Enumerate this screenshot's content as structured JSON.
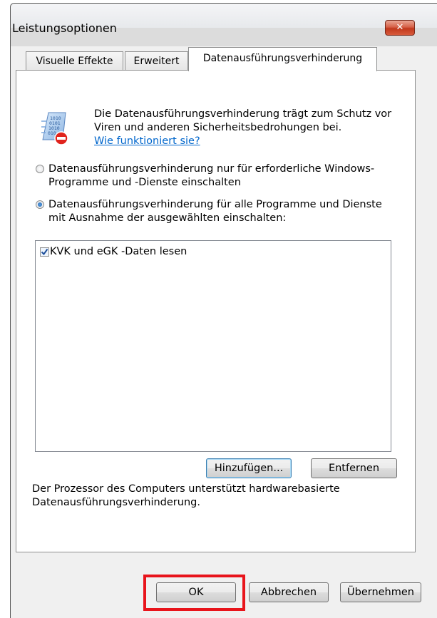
{
  "window": {
    "title": "Leistungsoptionen",
    "close_label": "✕"
  },
  "tabs": [
    {
      "label": "Visuelle Effekte",
      "active": false
    },
    {
      "label": "Erweitert",
      "active": false
    },
    {
      "label": "Datenausführungsverhinderung",
      "active": true
    }
  ],
  "dep": {
    "icon": "dep-shield-icon",
    "description": "Die Datenausführungsverhinderung trägt zum Schutz vor Viren und anderen Sicherheitsbedrohungen bei.",
    "link": "Wie funktioniert sie?"
  },
  "options": [
    {
      "label": "Datenausführungsverhinderung nur für erforderliche Windows-Programme und -Dienste einschalten",
      "selected": false
    },
    {
      "label": "Datenausführungsverhinderung für alle Programme und Dienste mit Ausnahme der ausgewählten einschalten:",
      "selected": true
    }
  ],
  "exceptions": [
    {
      "label": "KVK und eGK -Daten lesen",
      "checked": true
    }
  ],
  "list_buttons": {
    "add": "Hinzufügen...",
    "remove": "Entfernen"
  },
  "status": "Der Prozessor des Computers unterstützt hardwarebasierte Datenausführungsverhinderung.",
  "footer": {
    "ok": "OK",
    "cancel": "Abbrechen",
    "apply": "Übernehmen"
  },
  "colors": {
    "highlight": "#e8141b",
    "link": "#0066cc"
  }
}
